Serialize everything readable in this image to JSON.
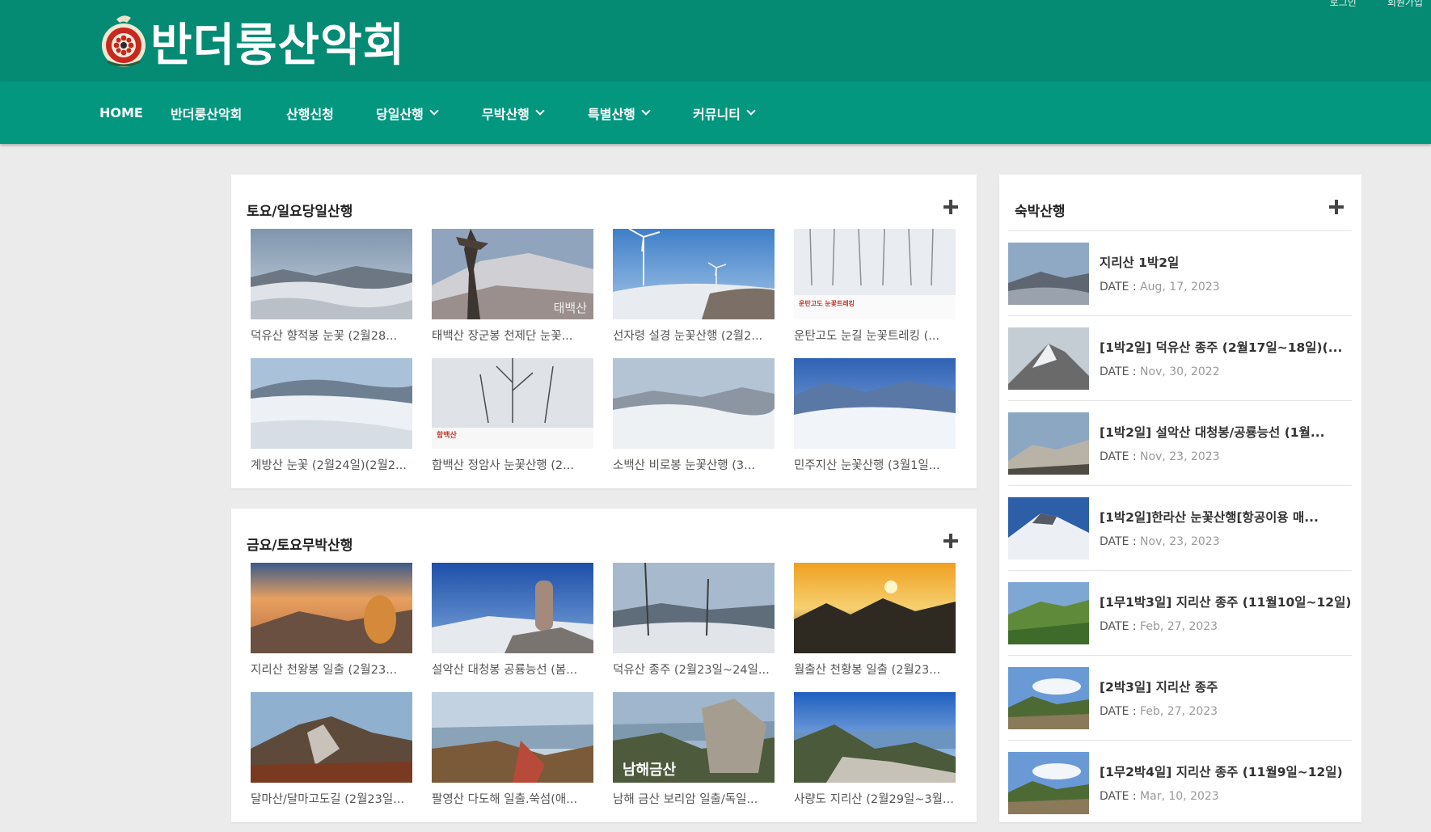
{
  "site": {
    "name": "반더룽산악회"
  },
  "top_links": [
    "로그인",
    "회원가입"
  ],
  "nav": [
    {
      "label": "HOME",
      "dropdown": false
    },
    {
      "label": "반더룽산악회",
      "dropdown": false
    },
    {
      "label": "산행신청",
      "dropdown": false
    },
    {
      "label": "당일산행",
      "dropdown": true
    },
    {
      "label": "무박산행",
      "dropdown": true
    },
    {
      "label": "특별산행",
      "dropdown": true
    },
    {
      "label": "커뮤니티",
      "dropdown": true
    }
  ],
  "section_day": {
    "title": "토요/일요당일산행",
    "items": [
      "덕유산 향적봉 눈꽃 (2월28...",
      "태백산 장군봉 천제단 눈꽃...",
      "선자령 설경 눈꽃산행 (2월2...",
      "운탄고도 눈길 눈꽃트레킹 (...",
      "계방산 눈꽃 (2월24일)(2월2...",
      "함백산 정암사 눈꽃산행 (2...",
      "소백산 비로봉 눈꽃산행 (3...",
      "민주지산 눈꽃산행 (3월1일..."
    ],
    "thumb_labels": {
      "1": "태백산",
      "3": "운탄고도 눈꽃트레킹",
      "5": "함백산"
    }
  },
  "section_night": {
    "title": "금요/토요무박산행",
    "items": [
      "지리산 천왕봉 일출 (2월23...",
      "설악산 대청봉 공룡능선 (봄...",
      "덕유산 종주 (2월23일~24일...",
      "월출산 천황봉 일출 (2월23...",
      "달마산/달마고도길 (2월23일...",
      "팔영산 다도해 일출.쑥섬(애...",
      "남해 금산 보리암 일출/독일...",
      "사량도 지리산 (2월29일~3월..."
    ],
    "thumb_labels": {
      "6": "남해금산"
    }
  },
  "sidebar": {
    "title": "숙박산행",
    "date_label": "DATE :",
    "items": [
      {
        "title": "지리산 1박2일",
        "date": "Aug, 17, 2023"
      },
      {
        "title": "[1박2일] 덕유산 종주 (2월17일~18일)(...",
        "date": "Nov, 30, 2022"
      },
      {
        "title": "[1박2일] 설악산 대청봉/공룡능선 (1월...",
        "date": "Nov, 23, 2023"
      },
      {
        "title": "[1박2일]한라산 눈꽃산행[항공이용 매...",
        "date": "Nov, 23, 2023"
      },
      {
        "title": "[1무1박3일] 지리산 종주 (11월10일~12일)",
        "date": "Feb, 27, 2023"
      },
      {
        "title": "[2박3일] 지리산 종주",
        "date": "Feb, 27, 2023"
      },
      {
        "title": "[1무2박4일] 지리산 종주 (11월9일~12일)",
        "date": "Mar, 10, 2023"
      }
    ]
  },
  "colors": {
    "header": "#058a74",
    "nav": "#04977f",
    "background": "#ebebeb"
  },
  "icons": {
    "plus": "plus-icon",
    "dropdown": "chevron-down-icon",
    "logo": "club-emblem-icon"
  }
}
